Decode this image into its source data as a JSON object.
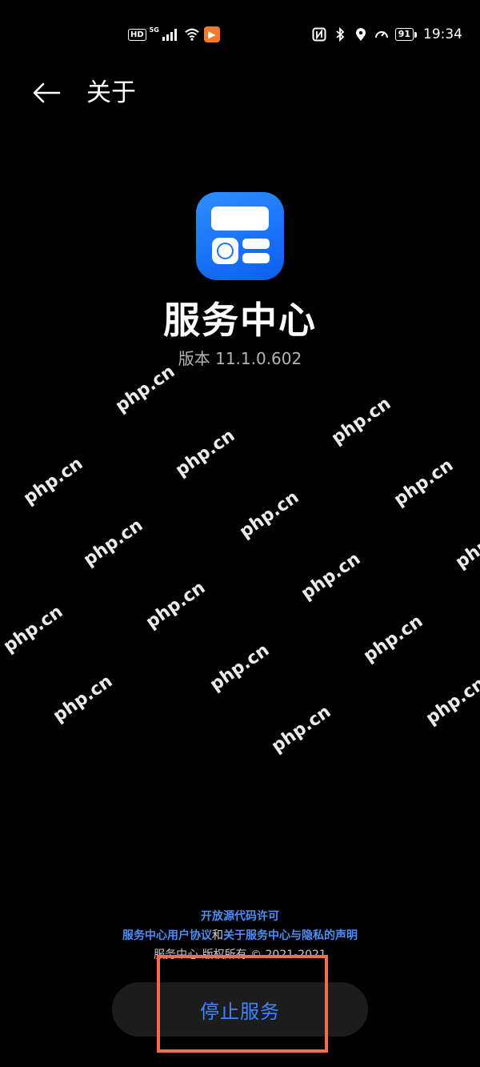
{
  "status_bar": {
    "hd": "HD",
    "network": "5G",
    "battery": "91",
    "time": "19:34",
    "app_badge_icon": "play-icon",
    "icons": [
      "nfc-icon",
      "bluetooth-icon",
      "location-icon",
      "speed-icon"
    ]
  },
  "header": {
    "back_icon": "back-arrow-icon",
    "title": "关于"
  },
  "app": {
    "icon": "service-center-icon",
    "name": "服务中心",
    "version": "版本 11.1.0.602"
  },
  "watermark": {
    "text": "php.cn"
  },
  "footer": {
    "open_source_link": "开放源代码许可",
    "user_agreement_link": "服务中心用户协议",
    "and_text": "和",
    "privacy_link": "关于服务中心与隐私的声明",
    "copyright": "服务中心 版权所有 © 2021-2021"
  },
  "action": {
    "stop_service_label": "停止服务"
  },
  "colors": {
    "link": "#4d8ef5",
    "button_text": "#3d86ff",
    "highlight": "#ef6f4d",
    "icon_bg": "#1f74ff"
  }
}
